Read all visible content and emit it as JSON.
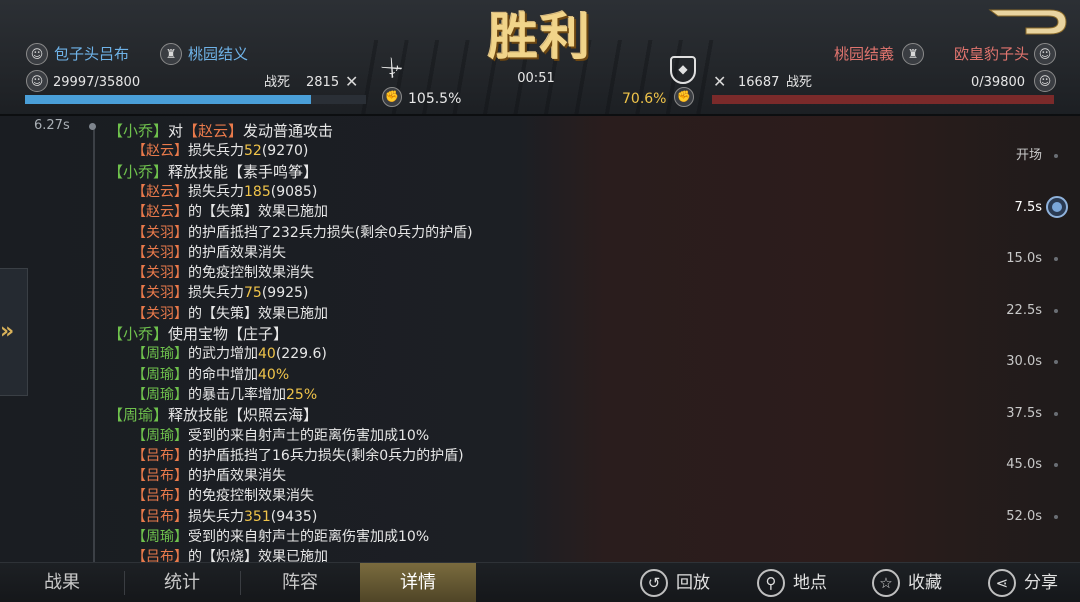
{
  "header": {
    "result_title": "胜利",
    "timer": "00:51",
    "left": {
      "commander": "包子头吕布",
      "alliance": "桃园结义",
      "troops": "29997/35800",
      "deaths_label": "战死",
      "deaths": "2815",
      "rate": "105.5%",
      "troop_ratio": 0.838
    },
    "right": {
      "commander": "欧皇豹子头",
      "alliance": "桃园结義",
      "troops": "0/39800",
      "deaths_label": "战死",
      "deaths": "16687",
      "rate": "70.6%",
      "troop_ratio": 0
    },
    "colors": {
      "left": "#4a9fd8",
      "right": "#8a3232",
      "gold": "#f1d48a"
    }
  },
  "log": {
    "timestamp": "6.27s",
    "lines": [
      [
        {
          "t": "【小乔】",
          "c": "g"
        },
        {
          "t": "对",
          "c": "w"
        },
        {
          "t": "【赵云】",
          "c": "o"
        },
        {
          "t": "发动普通攻击",
          "c": "w"
        }
      ],
      [
        {
          "t": "【赵云】",
          "c": "o"
        },
        {
          "t": "损失兵力",
          "c": "w"
        },
        {
          "t": "52",
          "c": "y"
        },
        {
          "t": "(9270)",
          "c": "w"
        }
      ],
      [
        {
          "t": "【小乔】",
          "c": "g"
        },
        {
          "t": "释放技能",
          "c": "w"
        },
        {
          "t": "【素手鸣筝】",
          "c": "w"
        }
      ],
      [
        {
          "t": "【赵云】",
          "c": "o"
        },
        {
          "t": "损失兵力",
          "c": "w"
        },
        {
          "t": "185",
          "c": "y"
        },
        {
          "t": "(9085)",
          "c": "w"
        }
      ],
      [
        {
          "t": "【赵云】",
          "c": "o"
        },
        {
          "t": "的【失策】效果已施加",
          "c": "w"
        }
      ],
      [
        {
          "t": "【关羽】",
          "c": "o"
        },
        {
          "t": "的护盾抵挡了232兵力损失(剩余0兵力的护盾)",
          "c": "w"
        }
      ],
      [
        {
          "t": "【关羽】",
          "c": "o"
        },
        {
          "t": "的护盾效果消失",
          "c": "w"
        }
      ],
      [
        {
          "t": "【关羽】",
          "c": "o"
        },
        {
          "t": "的免疫控制效果消失",
          "c": "w"
        }
      ],
      [
        {
          "t": "【关羽】",
          "c": "o"
        },
        {
          "t": "损失兵力",
          "c": "w"
        },
        {
          "t": "75",
          "c": "y"
        },
        {
          "t": "(9925)",
          "c": "w"
        }
      ],
      [
        {
          "t": "【关羽】",
          "c": "o"
        },
        {
          "t": "的【失策】效果已施加",
          "c": "w"
        }
      ],
      [
        {
          "t": "【小乔】",
          "c": "g"
        },
        {
          "t": "使用宝物",
          "c": "w"
        },
        {
          "t": "【庄子】",
          "c": "w"
        }
      ],
      [
        {
          "t": "【周瑜】",
          "c": "g"
        },
        {
          "t": "的武力增加",
          "c": "w"
        },
        {
          "t": "40",
          "c": "y"
        },
        {
          "t": "(229.6)",
          "c": "w"
        }
      ],
      [
        {
          "t": "【周瑜】",
          "c": "g"
        },
        {
          "t": "的命中增加",
          "c": "w"
        },
        {
          "t": "40%",
          "c": "y"
        }
      ],
      [
        {
          "t": "【周瑜】",
          "c": "g"
        },
        {
          "t": "的暴击几率增加",
          "c": "w"
        },
        {
          "t": "25%",
          "c": "y"
        }
      ],
      [
        {
          "t": "【周瑜】",
          "c": "g"
        },
        {
          "t": "释放技能",
          "c": "w"
        },
        {
          "t": "【炽照云海】",
          "c": "w"
        }
      ],
      [
        {
          "t": "【周瑜】",
          "c": "g"
        },
        {
          "t": "受到的来自射声士的距离伤害加成10%",
          "c": "w"
        }
      ],
      [
        {
          "t": "【吕布】",
          "c": "o"
        },
        {
          "t": "的护盾抵挡了16兵力损失(剩余0兵力的护盾)",
          "c": "w"
        }
      ],
      [
        {
          "t": "【吕布】",
          "c": "o"
        },
        {
          "t": "的护盾效果消失",
          "c": "w"
        }
      ],
      [
        {
          "t": "【吕布】",
          "c": "o"
        },
        {
          "t": "的免疫控制效果消失",
          "c": "w"
        }
      ],
      [
        {
          "t": "【吕布】",
          "c": "o"
        },
        {
          "t": "损失兵力",
          "c": "w"
        },
        {
          "t": "351",
          "c": "y"
        },
        {
          "t": "(9435)",
          "c": "w"
        }
      ],
      [
        {
          "t": "【周瑜】",
          "c": "g"
        },
        {
          "t": "受到的来自射声士的距离伤害加成10%",
          "c": "w"
        }
      ],
      [
        {
          "t": "【吕布】",
          "c": "o"
        },
        {
          "t": "的【炽烧】效果已施加",
          "c": "w"
        }
      ]
    ]
  },
  "timeline": {
    "labels": [
      "开场",
      "7.5s",
      "15.0s",
      "22.5s",
      "30.0s",
      "37.5s",
      "45.0s",
      "52.0s"
    ],
    "selected": "7.5s"
  },
  "tabs": [
    {
      "label": "战果"
    },
    {
      "label": "统计"
    },
    {
      "label": "阵容"
    },
    {
      "label": "详情",
      "active": true
    }
  ],
  "actions": [
    {
      "label": "回放",
      "icon": "replay-icon"
    },
    {
      "label": "地点",
      "icon": "location-pin-icon"
    },
    {
      "label": "收藏",
      "icon": "star-icon"
    },
    {
      "label": "分享",
      "icon": "share-icon"
    }
  ]
}
